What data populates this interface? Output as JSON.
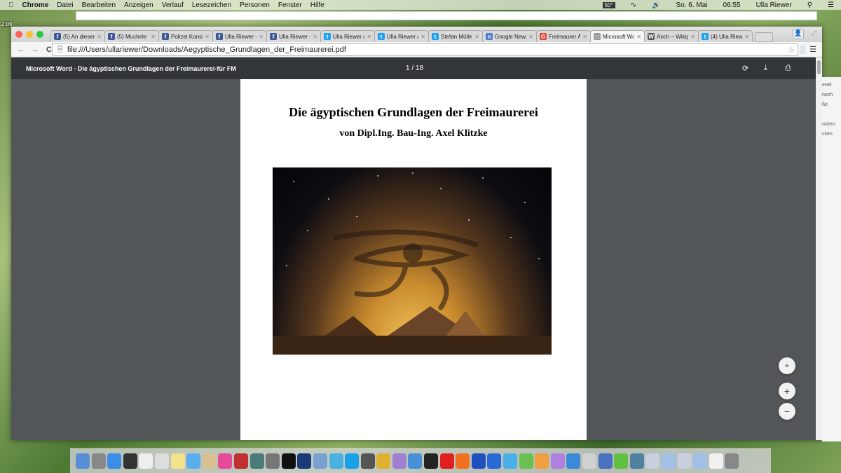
{
  "menubar": {
    "apple": "",
    "app": "Chrome",
    "items": [
      "Datei",
      "Bearbeiten",
      "Anzeigen",
      "Verlauf",
      "Lesezeichen",
      "Personen",
      "Fenster",
      "Hilfe"
    ],
    "status": {
      "temp": "50°",
      "date": "So. 6. Mai",
      "time": "06:55",
      "user": "Ulla Riewer"
    }
  },
  "desktop": {
    "clock": "2:09"
  },
  "tabs": [
    {
      "label": "(5) An diesem",
      "icon": "facebook-icon",
      "color": "#3b5998",
      "glyph": "f"
    },
    {
      "label": "(5) Muchele C",
      "icon": "facebook-icon",
      "color": "#3b5998",
      "glyph": "f"
    },
    {
      "label": "Polizei Konsta",
      "icon": "facebook-icon",
      "color": "#3b5998",
      "glyph": "f"
    },
    {
      "label": "Ulla Riewer - ",
      "icon": "facebook-icon",
      "color": "#3b5998",
      "glyph": "f"
    },
    {
      "label": "Ulla Riewer - /",
      "icon": "facebook-icon",
      "color": "#3b5998",
      "glyph": "f"
    },
    {
      "label": "Ulla Riewer au",
      "icon": "twitter-icon",
      "color": "#1da1f2",
      "glyph": "t"
    },
    {
      "label": "Ulla Riewer au",
      "icon": "twitter-icon",
      "color": "#1da1f2",
      "glyph": "t"
    },
    {
      "label": "Stefan Müller (",
      "icon": "twitter-icon",
      "color": "#1da1f2",
      "glyph": "t"
    },
    {
      "label": "Google News",
      "icon": "google-news-icon",
      "color": "#4a7bd0",
      "glyph": "n"
    },
    {
      "label": "Freimaurer Äg",
      "icon": "google-icon",
      "color": "#db4437",
      "glyph": "G"
    },
    {
      "label": "Microsoft Wor",
      "icon": "document-icon",
      "color": "#999999",
      "glyph": "□",
      "active": true
    },
    {
      "label": "Anch – Wikipe",
      "icon": "wikipedia-icon",
      "color": "#555555",
      "glyph": "W"
    },
    {
      "label": "(4) Ulla Riewe",
      "icon": "twitter-icon",
      "color": "#1da1f2",
      "glyph": "t"
    }
  ],
  "address": {
    "url": "file:///Users/ullariewer/Downloads/Aegyptische_Grundlagen_der_Freimaurerei.pdf"
  },
  "pdf": {
    "title": "Microsoft Word - Die ägyptischen Grundlagen der Freimaurerei-für FM",
    "page": "1",
    "total": "18",
    "page_sep": "/"
  },
  "document": {
    "heading": "Die ägyptischen Grundlagen der Freimaurerei",
    "subheading": "von Dipl.Ing. Bau-Ing. Axel Klitzke"
  },
  "right_window": [
    "ereit",
    "noch",
    "ße",
    "",
    "ucken",
    "cken"
  ],
  "dock_colors": [
    "#5a8fd8",
    "#888",
    "#3a8ee8",
    "#333",
    "#eee",
    "#ddd",
    "#f3e28a",
    "#5aaef0",
    "#d8c090",
    "#e84a9a",
    "#c03030",
    "#4a7a7a",
    "#777",
    "#111",
    "#1a3a7a",
    "#7aa0d0",
    "#4ab0e0",
    "#1aa0e8",
    "#555",
    "#e0b030",
    "#a080d0",
    "#4a90d8",
    "#222",
    "#e02020",
    "#f07020",
    "#2050c0",
    "#2a6ad8",
    "#4ab0e8",
    "#6ac050",
    "#f0a040",
    "#b080e0",
    "#3a8ad8",
    "#d0d0d0",
    "#4a70c0",
    "#60c040",
    "#5080a0",
    "#c8d0e0",
    "#a0c0e8",
    "#c8d0e0",
    "#a0c0e8",
    "#f0f0f0",
    "#888"
  ],
  "colors": {
    "toolbar": "#323639",
    "viewer_bg": "#525659"
  }
}
